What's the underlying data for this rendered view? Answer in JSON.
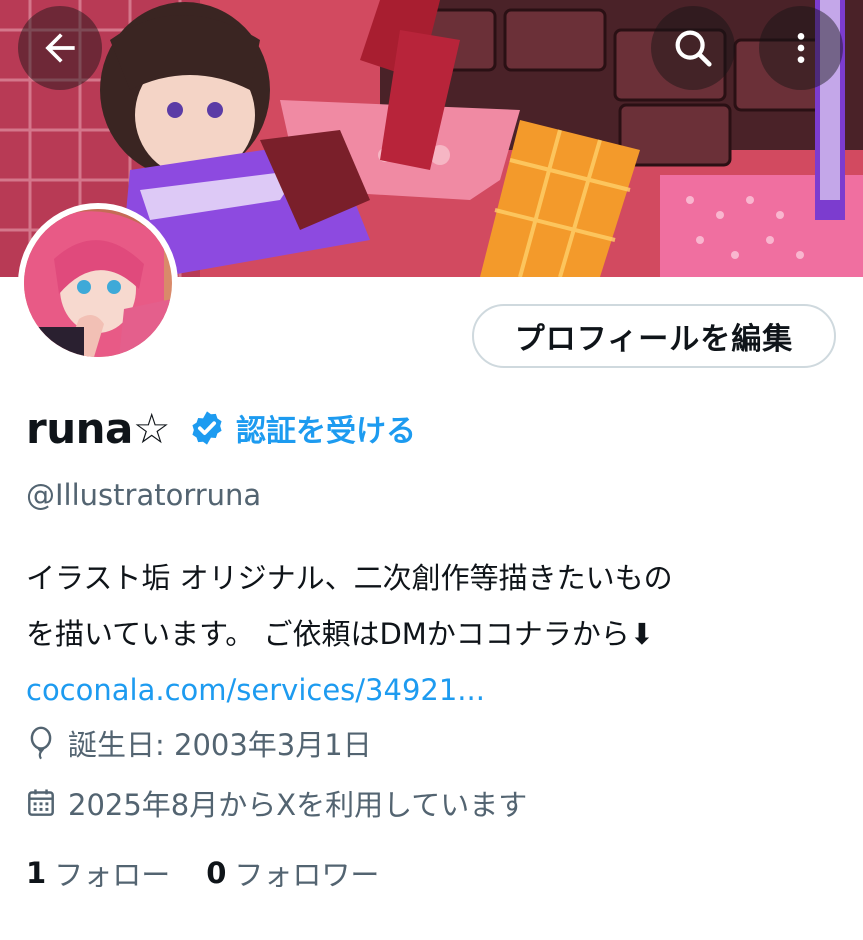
{
  "header": {
    "back_icon": "arrow-left-icon",
    "search_icon": "search-icon",
    "more_icon": "more-vertical-icon"
  },
  "profile": {
    "display_name": "runa☆",
    "verified_badge_color": "#1d9bf0",
    "get_verified_label": "認証を受ける",
    "handle": "@Illustratorruna",
    "edit_profile_label": "プロフィールを編集",
    "bio_line1": "イラスト垢 オリジナル、二次創作等描きたいもの",
    "bio_line2": "を描いています。 ご依頼はDMかココナラから⬇",
    "bio_link": "coconala.com/services/34921...",
    "birthday": "誕生日: 2003年3月1日",
    "joined": "2025年8月からXを利用しています",
    "following_count": "1",
    "following_label": "フォロー",
    "followers_count": "0",
    "followers_label": "フォロワー"
  },
  "colors": {
    "accent": "#1d9bf0",
    "text_primary": "#0f1419",
    "text_secondary": "#536471",
    "border": "#cfd9de"
  }
}
